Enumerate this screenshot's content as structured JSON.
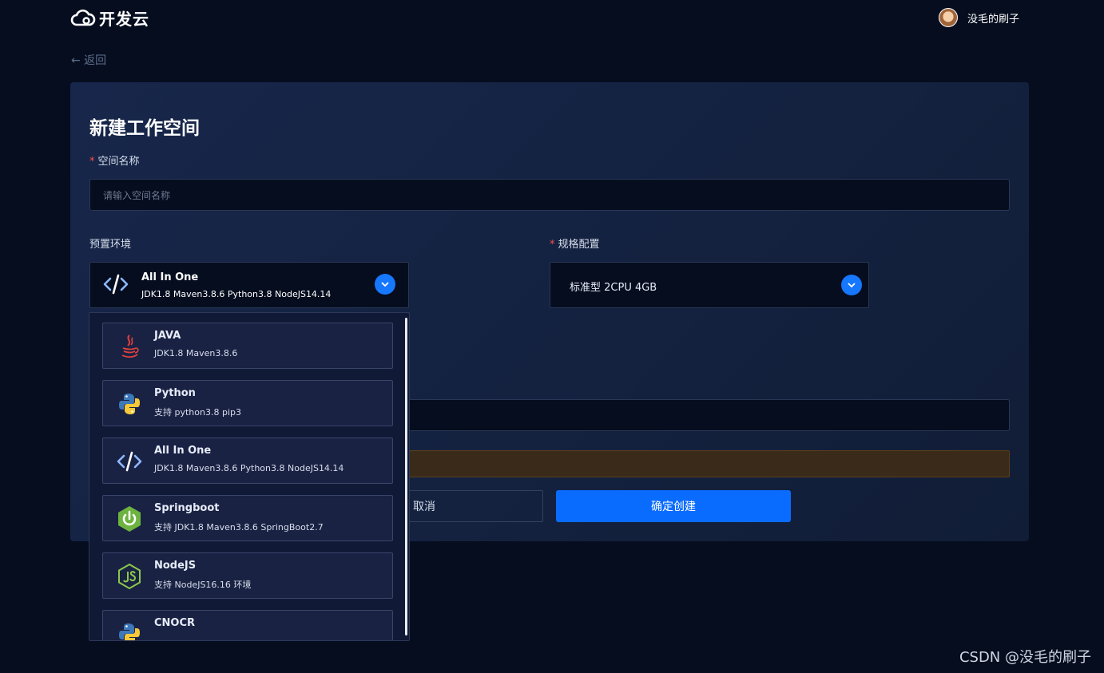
{
  "header": {
    "logo_text": "开发云",
    "user_name": "没毛的刷子"
  },
  "back_label": "← 返回",
  "form": {
    "title": "新建工作空间",
    "name_label": "空间名称",
    "name_required": "*",
    "name_placeholder": "请输入空间名称",
    "env_label": "预置环境",
    "env_selected": {
      "name": "All In One",
      "desc": "JDK1.8 Maven3.8.6 Python3.8 NodeJS14.14"
    },
    "spec_label": "规格配置",
    "spec_required": "*",
    "spec_value": "标准型 2CPU 4GB",
    "cancel_label": "取消",
    "confirm_label": "确定创建"
  },
  "dropdown": {
    "options": [
      {
        "name": "JAVA",
        "desc": "JDK1.8 Maven3.8.6",
        "icon": "java-icon"
      },
      {
        "name": "Python",
        "desc": "支持 python3.8 pip3",
        "icon": "python-icon"
      },
      {
        "name": "All In One",
        "desc": "JDK1.8 Maven3.8.6 Python3.8 NodeJS14.14",
        "icon": "code-icon"
      },
      {
        "name": "Springboot",
        "desc": "支持 JDK1.8 Maven3.8.6 SpringBoot2.7",
        "icon": "springboot-icon"
      },
      {
        "name": "NodeJS",
        "desc": "支持 NodeJS16.16 环境",
        "icon": "nodejs-icon"
      },
      {
        "name": "CNOCR",
        "desc": "",
        "icon": "python-icon"
      }
    ]
  },
  "colors": {
    "primary": "#0a6cff",
    "background": "#050d1f",
    "required": "#ff4d4f"
  },
  "watermark": "CSDN @没毛的刷子"
}
